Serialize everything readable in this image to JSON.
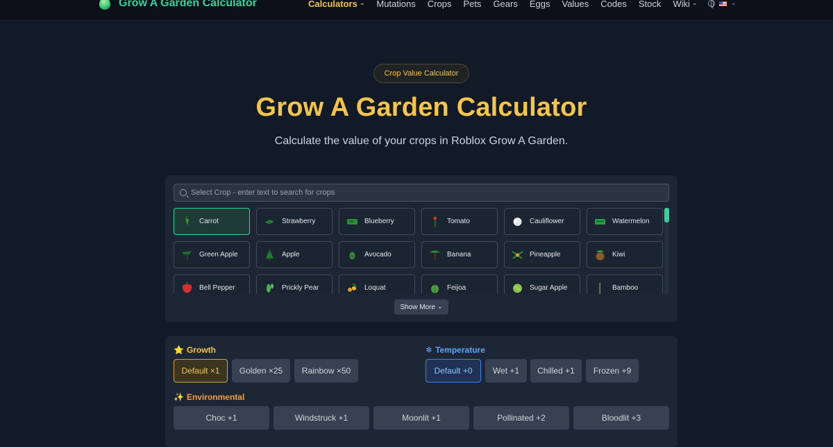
{
  "nav": {
    "brand": "Grow A Garden Calculator",
    "links": [
      {
        "label": "Calculators",
        "active": true,
        "has_dropdown": true
      },
      {
        "label": "Mutations"
      },
      {
        "label": "Crops"
      },
      {
        "label": "Pets"
      },
      {
        "label": "Gears"
      },
      {
        "label": "Eggs"
      },
      {
        "label": "Values"
      },
      {
        "label": "Codes"
      },
      {
        "label": "Stock"
      },
      {
        "label": "Wiki",
        "has_dropdown": true
      }
    ],
    "language_icon": "globe-icon",
    "language_flag": "us-flag-icon"
  },
  "hero": {
    "badge": "Crop Value Calculator",
    "title": "Grow A Garden Calculator",
    "subtitle": "Calculate the value of your crops in Roblox Grow A Garden."
  },
  "crop_selector": {
    "search_placeholder": "Select Crop - enter text to search for crops",
    "selected": "Carrot",
    "crops": [
      {
        "name": "Carrot",
        "icon": "carrot-icon"
      },
      {
        "name": "Strawberry",
        "icon": "strawberry-icon"
      },
      {
        "name": "Blueberry",
        "icon": "blueberry-icon"
      },
      {
        "name": "Tomato",
        "icon": "tomato-icon"
      },
      {
        "name": "Cauliflower",
        "icon": "cauliflower-icon"
      },
      {
        "name": "Watermelon",
        "icon": "watermelon-icon"
      },
      {
        "name": "Green Apple",
        "icon": "green-apple-icon"
      },
      {
        "name": "Apple",
        "icon": "apple-icon"
      },
      {
        "name": "Avocado",
        "icon": "avocado-icon"
      },
      {
        "name": "Banana",
        "icon": "banana-icon"
      },
      {
        "name": "Pineapple",
        "icon": "pineapple-icon"
      },
      {
        "name": "Kiwi",
        "icon": "kiwi-icon"
      },
      {
        "name": "Bell Pepper",
        "icon": "bell-pepper-icon"
      },
      {
        "name": "Prickly Pear",
        "icon": "prickly-pear-icon"
      },
      {
        "name": "Loquat",
        "icon": "loquat-icon"
      },
      {
        "name": "Feijoa",
        "icon": "feijoa-icon"
      },
      {
        "name": "Sugar Apple",
        "icon": "sugar-apple-icon"
      },
      {
        "name": "Bamboo",
        "icon": "bamboo-icon"
      }
    ],
    "show_more_label": "Show More"
  },
  "modifiers": {
    "growth": {
      "label": "Growth",
      "icon": "star-icon",
      "options": [
        "Default ×1",
        "Golden ×25",
        "Rainbow ×50"
      ],
      "selected": "Default ×1"
    },
    "temperature": {
      "label": "Temperature",
      "icon": "snowflake-icon",
      "options": [
        "Default +0",
        "Wet +1",
        "Chilled +1",
        "Frozen +9"
      ],
      "selected": "Default +0"
    },
    "environmental": {
      "label": "Environmental",
      "icon": "sparkles-icon",
      "options": [
        "Choc +1",
        "Windstruck +1",
        "Moonlit +1",
        "Pollinated +2",
        "Bloodlit +3"
      ]
    }
  },
  "colors": {
    "accent_gold": "#f5c54a",
    "accent_green": "#34d399",
    "accent_blue": "#60a5fa",
    "background": "#121a27"
  }
}
